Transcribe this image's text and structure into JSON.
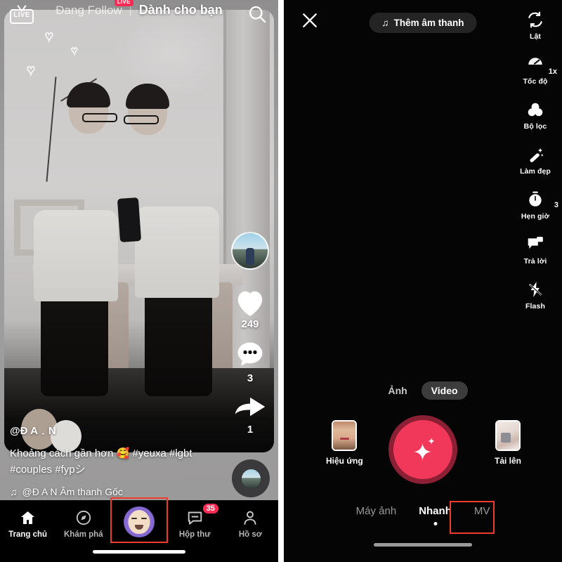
{
  "left_panel": {
    "top_bar": {
      "live_icon_label": "LIVE",
      "tab_following": "Đang Follow",
      "tab_following_badge": "LIVE",
      "tab_divider": "|",
      "tab_foryou": "Dành cho bạn",
      "search_icon": "search-icon"
    },
    "action_rail": {
      "avatar_label": "creator-avatar",
      "like_icon": "heart-icon",
      "like_count": "249",
      "comment_icon": "comment-icon",
      "comment_count": "3",
      "share_icon": "share-arrow-icon",
      "share_count": "1",
      "music_disc": "music-disc-icon"
    },
    "caption": {
      "username": "@Đ A﹒N",
      "text_line1": "Khoảng cách gần hơn 🥰 #yeuxa #lgbt",
      "text_line2": "#couples #fypシ",
      "music_note_icon": "music-note-icon",
      "music_text": "@Đ A N Âm thanh Gốc"
    },
    "bottom_nav": {
      "items": [
        {
          "label": "Trang chủ",
          "icon": "home-icon",
          "active": true
        },
        {
          "label": "Khám phá",
          "icon": "compass-icon",
          "active": false
        },
        {
          "label": "",
          "icon": "profile-avatar-icon",
          "active": false
        },
        {
          "label": "Hộp thư",
          "icon": "inbox-icon",
          "badge": "35",
          "active": false
        },
        {
          "label": "Hồ sơ",
          "icon": "person-icon",
          "active": false
        }
      ]
    },
    "highlight_color": "#ef3a2d"
  },
  "right_panel": {
    "top_bar": {
      "close_icon": "close-icon",
      "add_sound_label": "Thêm âm thanh",
      "add_sound_icon": "music-note-icon"
    },
    "tools": [
      {
        "label": "Lật",
        "icon": "flip-camera-icon"
      },
      {
        "label": "Tốc độ",
        "icon": "speed-icon",
        "value": "1x"
      },
      {
        "label": "Bộ lọc",
        "icon": "filter-icon"
      },
      {
        "label": "Làm đẹp",
        "icon": "beautify-wand-icon"
      },
      {
        "label": "Hẹn giờ",
        "icon": "timer-icon",
        "value": "3"
      },
      {
        "label": "Trả lời",
        "icon": "reply-icon"
      },
      {
        "label": "Flash",
        "icon": "flash-off-icon"
      }
    ],
    "capture_modes": [
      {
        "label": "Ảnh",
        "selected": false
      },
      {
        "label": "Video",
        "selected": true
      }
    ],
    "shutter": {
      "icon": "sparkle-icon",
      "fill_color": "#f1385a",
      "ring_color": "#8b1f33"
    },
    "effects_button": {
      "label": "Hiệu ứng",
      "icon": "effects-thumbnail"
    },
    "upload_button": {
      "label": "Tải lên",
      "icon": "upload-thumbnail"
    },
    "bottom_modes": [
      {
        "label": "Máy ảnh",
        "active": false
      },
      {
        "label": "Nhanh",
        "active": true
      },
      {
        "label": "MV",
        "active": false,
        "highlighted": true
      }
    ],
    "highlight_color": "#ef3a2d"
  }
}
